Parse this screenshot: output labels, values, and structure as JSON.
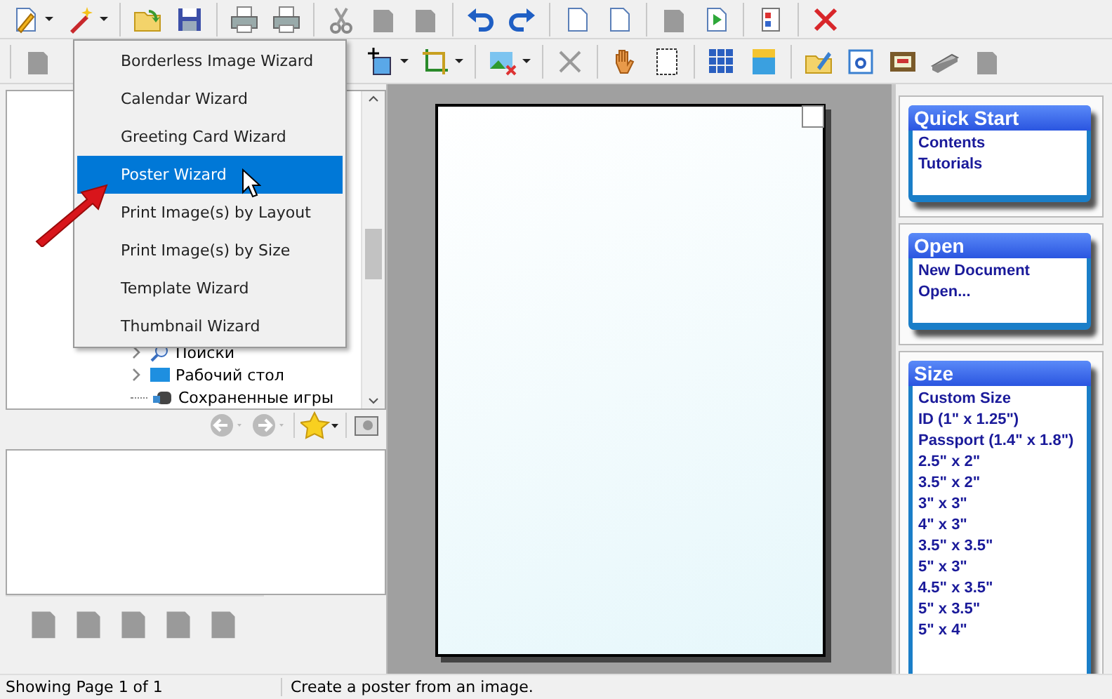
{
  "wizard_menu": [
    {
      "label": "Borderless Image Wizard",
      "selected": false
    },
    {
      "label": "Calendar Wizard",
      "selected": false
    },
    {
      "label": "Greeting Card Wizard",
      "selected": false
    },
    {
      "label": "Poster Wizard",
      "selected": true
    },
    {
      "label": "Print Image(s) by Layout",
      "selected": false
    },
    {
      "label": "Print Image(s) by Size",
      "selected": false
    },
    {
      "label": "Template Wizard",
      "selected": false
    },
    {
      "label": "Thumbnail Wizard",
      "selected": false
    }
  ],
  "folder_tree": [
    {
      "label": "Поиски",
      "expandable": true
    },
    {
      "label": "Рабочий стол",
      "expandable": true
    },
    {
      "label": "Сохраненные игры",
      "expandable": false
    }
  ],
  "task_panels": [
    {
      "title": "Quick Start",
      "links": [
        "Contents",
        "Tutorials"
      ]
    },
    {
      "title": "Open",
      "links": [
        "New Document",
        "Open..."
      ]
    },
    {
      "title": "Size",
      "links": [
        "Custom Size",
        "ID (1\" x 1.25\")",
        "Passport (1.4\" x 1.8\")",
        "2.5\" x 2\"",
        "3.5\" x 2\"",
        "3\" x 3\"",
        "4\" x 3\"",
        "3.5\" x 3.5\"",
        "5\" x 3\"",
        "4.5\" x 3.5\"",
        "5\" x 3.5\"",
        "5\" x 4\""
      ]
    }
  ],
  "status_bar": {
    "page_info": "Showing Page 1 of 1",
    "hint": "Create a poster from an image."
  }
}
